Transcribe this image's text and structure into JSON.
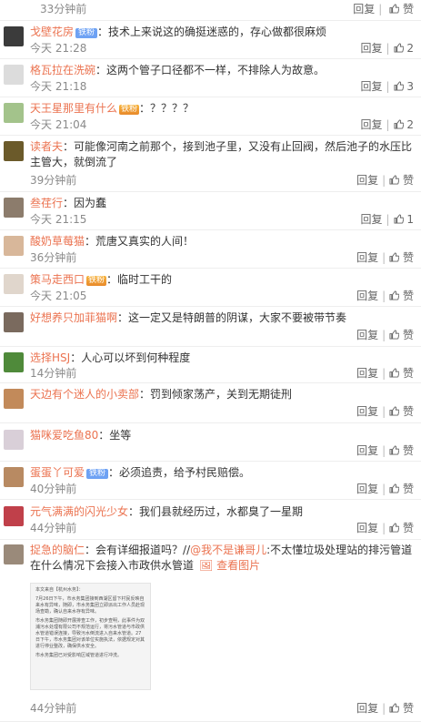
{
  "actions": {
    "reply": "回复",
    "like": "赞"
  },
  "top": {
    "time": "33分钟前"
  },
  "comments": [
    {
      "name": "戈壁花房",
      "badge": "铁粉",
      "text": "技术上来说这的确挺迷惑的，存心做都很麻烦",
      "time": "今天 21:28",
      "likes": "2"
    },
    {
      "name": "格瓦拉在洗碗",
      "text": "这两个管子口径都不一样，不排除人为故意。",
      "time": "今天 21:18",
      "likes": "3"
    },
    {
      "name": "天王星那里有什么",
      "badge2": "铁粉",
      "text": "？？？？",
      "time": "今天 21:04",
      "likes": "2"
    },
    {
      "name": "读者夫",
      "text": "可能像河南之前那个，接到池子里，又没有止回阀，然后池子的水压比主管大，就倒流了",
      "time": "39分钟前",
      "likes": ""
    },
    {
      "name": "叁荏行",
      "text": "因为蠢",
      "time": "今天 21:15",
      "likes": "1"
    },
    {
      "name": "酸奶草莓猫",
      "text": "荒唐又真实的人间！",
      "time": "36分钟前",
      "likes": ""
    },
    {
      "name": "策马走西口",
      "badge2": "铁粉",
      "text": "临时工干的",
      "time": "今天 21:05",
      "likes": ""
    },
    {
      "name": "好想养只加菲猫啊",
      "text": "这一定又是特朗普的阴谋，大家不要被带节奏",
      "time": "",
      "likes": ""
    },
    {
      "name": "选择HSJ",
      "text": "人心可以坏到何种程度",
      "time": "14分钟前",
      "likes": ""
    },
    {
      "name": "天边有个迷人的小卖部",
      "text": "罚到倾家荡产，关到无期徒刑",
      "time": "",
      "likes": ""
    },
    {
      "name": "猫咪爱吃鱼80",
      "text": "坐等",
      "time": "",
      "likes": ""
    },
    {
      "name": "蛋蛋丫可爱",
      "badge": "铁粉",
      "text": "必须追责，给予村民赔偿。",
      "time": "40分钟前",
      "likes": ""
    },
    {
      "name": "元气满满的闪光少女",
      "text": "我们县就经历过，水都臭了一星期",
      "time": "44分钟前",
      "likes": ""
    },
    {
      "name": "捉急的脑仁",
      "text": "会有详细报道吗？//",
      "mention": "@我不是谦哥儿",
      "text2": ":不太懂垃圾处理站的排污管道在什么情况下会接入市政供水管道",
      "pic": "查看图片",
      "time": "44分钟前",
      "likes": ""
    }
  ],
  "article": {
    "head": "本文来自【杭州水务】：",
    "p1": "7月26日下午，市水务集团接到西湖区留下村民反映自来水有异味，随即，市水务集团立即派出工作人员赴现场查勘，确认自来水存有异味。",
    "p2": "市水务集团随即开展排查工作，初步查明，此事件为双浦污水处理有限公司不规范运行，将污水管道与市政供水管道错误连接，导致污水倒流进入自来水管道。27日下午，市水务集团对该单位实施执法，依据规定对其进行停业整改，确保供水安全。",
    "p3": "市水务集团已对受影响区域管道进行冲洗。"
  },
  "colors": {
    "name": "#eb7350",
    "badge": "#6ea2f4",
    "time": "#8a8a8a"
  }
}
